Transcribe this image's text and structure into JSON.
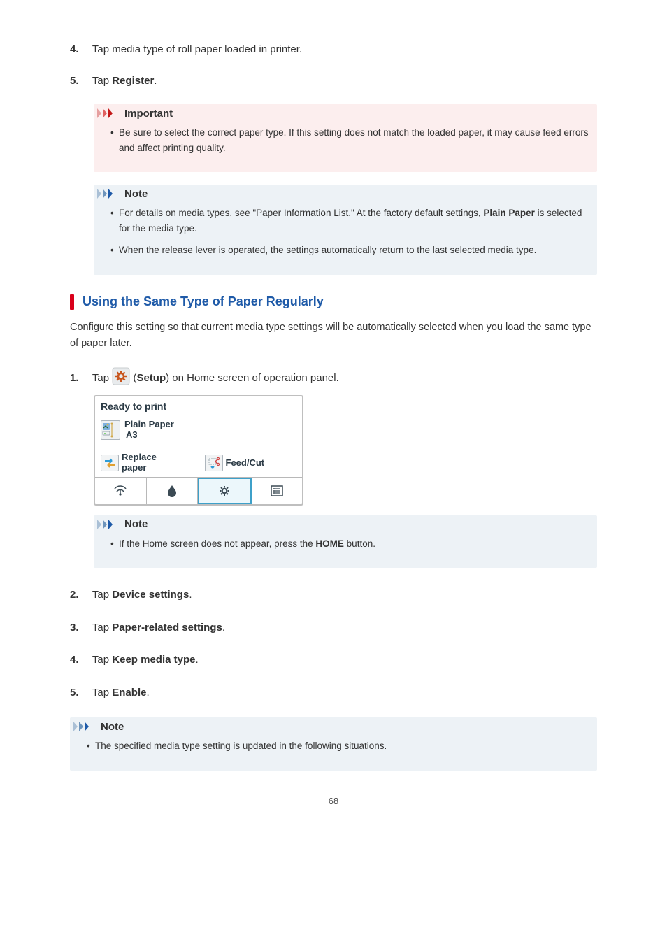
{
  "steps_top": {
    "4": {
      "prefix": "4.",
      "text_before": "Tap media type of roll paper loaded in printer.",
      "bold": ""
    },
    "5": {
      "prefix": "5.",
      "text_before": "Tap ",
      "bold": "Register",
      "text_after": "."
    }
  },
  "important": {
    "label": "Important",
    "items": [
      "Be sure to select the correct paper type. If this setting does not match the loaded paper, it may cause feed errors and affect printing quality."
    ]
  },
  "note1": {
    "label": "Note",
    "item1_prefix": "For details on media types, see \"Paper Information List.\" At the factory default settings, ",
    "item1_bold": "Plain Paper",
    "item1_suffix": " is selected for the media type.",
    "item2": "When the release lever is operated, the settings automatically return to the last selected media type."
  },
  "section": {
    "title": "Using the Same Type of Paper Regularly",
    "intro": "Configure this setting so that current media type settings will be automatically selected when you load the same type of paper later."
  },
  "step1": {
    "prefix": "1.",
    "text_a": "Tap ",
    "bold_a": "Setup",
    "text_b": ") on Home screen of operation panel."
  },
  "panel": {
    "title": "Ready to print",
    "paper_type": "Plain Paper",
    "paper_size": "A3",
    "replace": "Replace\npaper",
    "feedcut": "Feed/Cut"
  },
  "note2": {
    "label": "Note",
    "item_prefix": "If the Home screen does not appear, press the ",
    "item_bold": "HOME",
    "item_suffix": " button."
  },
  "steps_bottom": {
    "2": {
      "prefix": "2.",
      "a": "Tap ",
      "b": "Device settings",
      "c": "."
    },
    "3": {
      "prefix": "3.",
      "a": "Tap ",
      "b": "Paper-related settings",
      "c": "."
    },
    "4": {
      "prefix": "4.",
      "a": "Tap ",
      "b": "Keep media type",
      "c": "."
    },
    "5": {
      "prefix": "5.",
      "a": "Tap ",
      "b": "Enable",
      "c": "."
    }
  },
  "note3": {
    "label": "Note",
    "item": "The specified media type setting is updated in the following situations."
  },
  "page_number": "68"
}
